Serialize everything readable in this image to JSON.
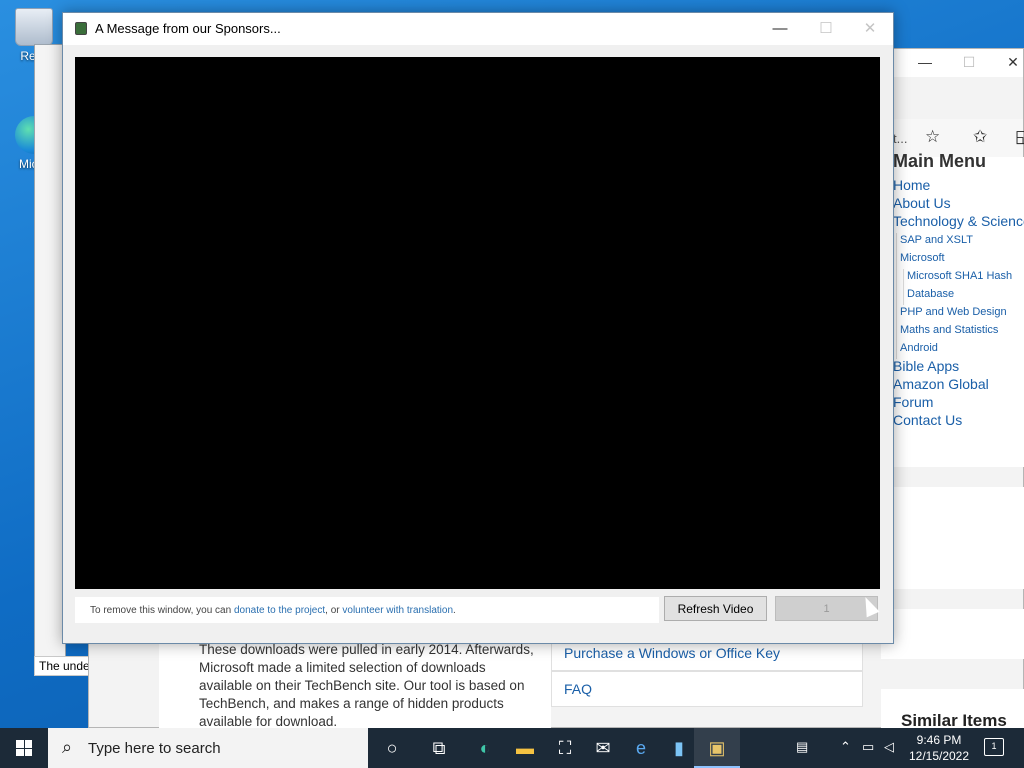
{
  "desktop": {
    "icons": [
      {
        "label": "Recy"
      },
      {
        "label": "Mic E"
      }
    ]
  },
  "background_window": {
    "status_text": "The underlying connec"
  },
  "browser": {
    "controls": {
      "minimize": "—",
      "maximize": "☐",
      "close": "✕"
    },
    "toolbar": {
      "truncated_text": "t...",
      "icons": [
        "favorite-add-icon",
        "favorites-icon",
        "collections-icon"
      ]
    },
    "main_menu": {
      "title": "Main Menu",
      "items": [
        {
          "label": "Home",
          "level": 1
        },
        {
          "label": "About Us",
          "level": 1
        },
        {
          "label": "Technology & Science",
          "level": 1
        },
        {
          "label": "SAP and XSLT",
          "level": 2
        },
        {
          "label": "Microsoft",
          "level": 2
        },
        {
          "label": "Microsoft SHA1 Hash",
          "level": 3
        },
        {
          "label": "Database",
          "level": 3
        },
        {
          "label": "PHP and Web Design",
          "level": 2
        },
        {
          "label": "Maths and Statistics",
          "level": 2
        },
        {
          "label": "Android",
          "level": 2
        },
        {
          "label": "Bible Apps",
          "level": 1
        },
        {
          "label": "Amazon Global",
          "level": 1
        },
        {
          "label": "Forum",
          "level": 1
        },
        {
          "label": "Contact Us",
          "level": 1
        }
      ]
    },
    "similar_items_title": "Similar Items",
    "article_text": "These downloads were pulled in early 2014. Afterwards, Microsoft made a limited selection of downloads available on their TechBench site. Our tool is based on TechBench, and makes a range of hidden products available for download.",
    "links": [
      "Purchase a Windows or Office Key",
      "FAQ"
    ]
  },
  "dialog": {
    "title": "A Message from our Sponsors...",
    "controls": {
      "minimize": "—",
      "maximize": "☐",
      "close": "✕"
    },
    "notice_prefix": "To remove this window, you can ",
    "notice_link1": "donate to the project",
    "notice_middle": ", or ",
    "notice_link2": "volunteer with translation",
    "notice_suffix": ".",
    "refresh_button": "Refresh Video",
    "counter_button": "1"
  },
  "taskbar": {
    "search_placeholder": "Type here to search",
    "clock_time": "9:46 PM",
    "clock_date": "12/15/2022",
    "notification_count": "1",
    "apps": [
      "cortana-icon",
      "task-view-icon",
      "edge-icon",
      "file-explorer-icon",
      "store-icon",
      "mail-icon",
      "internet-explorer-icon",
      "notepad-icon",
      "app-icon"
    ]
  }
}
